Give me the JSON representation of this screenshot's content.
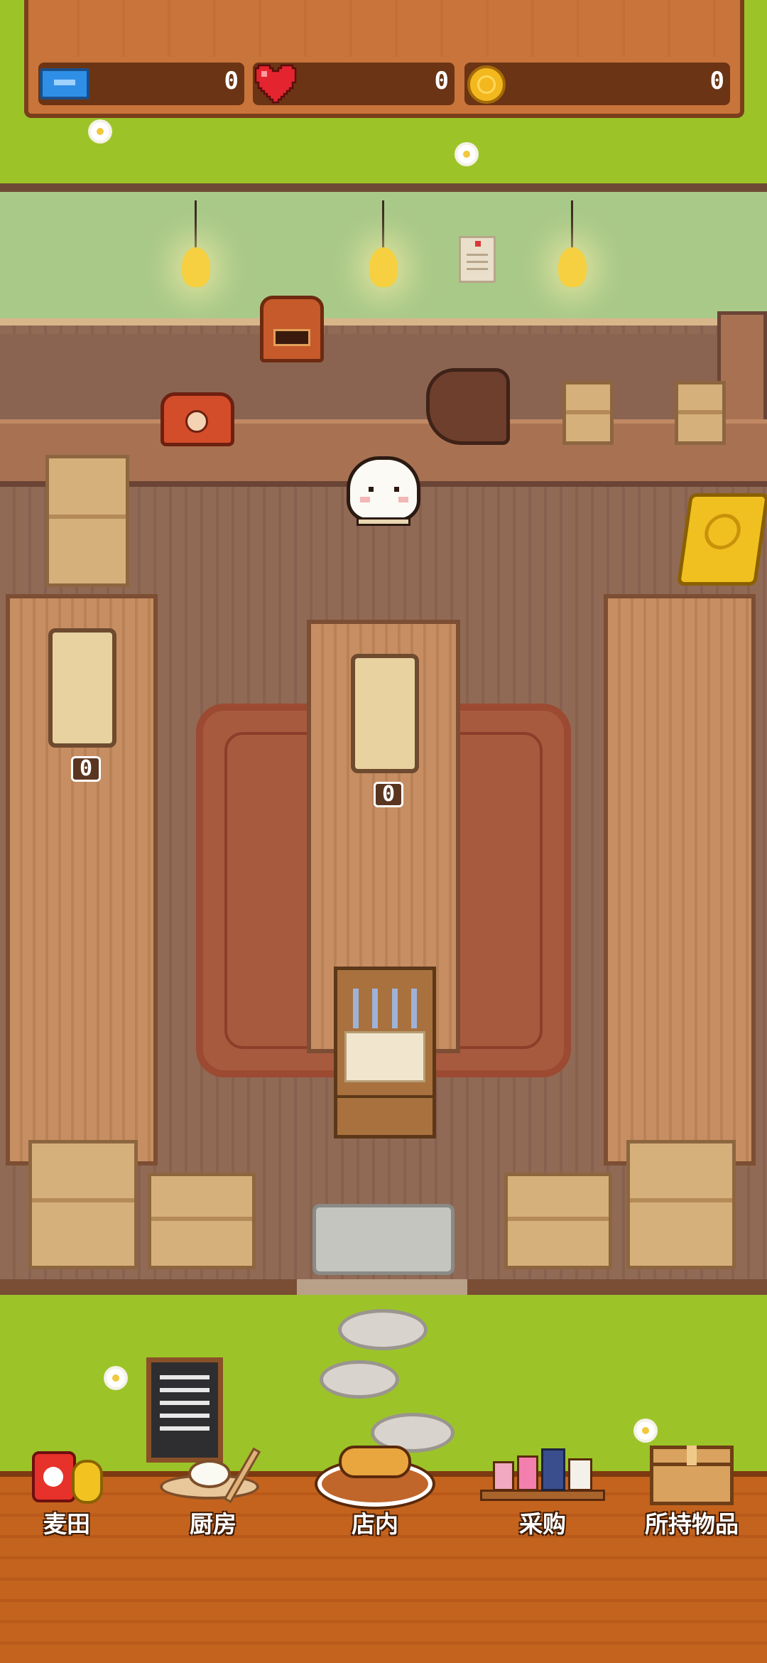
{
  "resources": {
    "tickets": "0",
    "hearts": "0",
    "coins": "0"
  },
  "shop": {
    "left_shelf_count": "0",
    "center_shelf_count": "0"
  },
  "nav": {
    "items": [
      {
        "label": "麦田",
        "icon": "wheat-field-icon"
      },
      {
        "label": "厨房",
        "icon": "kitchen-icon"
      },
      {
        "label": "店内",
        "icon": "shop-icon"
      },
      {
        "label": "采购",
        "icon": "purchase-icon"
      },
      {
        "label": "所持物品",
        "icon": "inventory-icon"
      }
    ]
  },
  "colors": {
    "grass": "#9cc428",
    "wood_bar": "#c4631d",
    "wall": "#a9c989",
    "floor": "#916a55"
  }
}
